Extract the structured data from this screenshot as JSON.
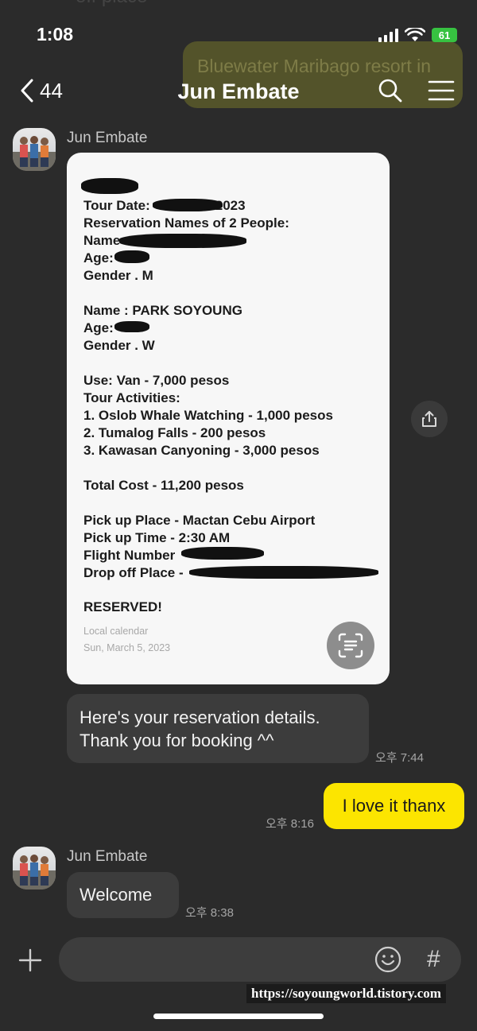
{
  "status_bar": {
    "time": "1:08",
    "battery": "61"
  },
  "header": {
    "back_count": "44",
    "title": "Jun Embate"
  },
  "background": {
    "ghost_text_top": "off place",
    "ghost_bubble_text": "Bluewater Maribago resort in"
  },
  "messages": [
    {
      "sender": "Jun Embate",
      "type": "image",
      "image_lines": {
        "tour_date": "Tour Date:",
        "tour_date_year": "2023",
        "reservation_names": "Reservation Names of 2 People:",
        "name1_label": "Name",
        "age1": "Age:",
        "gender1": "Gender . M",
        "name2": "Name : PARK SOYOUNG",
        "age2": "Age:",
        "gender2": "Gender . W",
        "use": "Use: Van - 7,000 pesos",
        "tour_activities": "Tour Activities:",
        "activity1": "1. Oslob Whale Watching - 1,000 pesos",
        "activity2": "2. Tumalog Falls - 200 pesos",
        "activity3": "3. Kawasan Canyoning - 3,000 pesos",
        "total": "Total Cost - 11,200 pesos",
        "pickup_place": "Pick up Place - Mactan Cebu Airport",
        "pickup_time": "Pick up Time - 2:30 AM",
        "flight_number": "Flight Number",
        "dropoff": "Drop off Place -",
        "reserved": "RESERVED!",
        "calendar_label": "Local calendar",
        "calendar_date": "Sun, March 5, 2023"
      }
    },
    {
      "sender": "Jun Embate",
      "type": "text",
      "line1": "Here's your reservation details.",
      "line2": "Thank you for booking ^^",
      "time": "오후 7:44"
    },
    {
      "sender": "me",
      "type": "text",
      "text": "I love it thanx",
      "time": "오후 8:16"
    },
    {
      "sender": "Jun Embate",
      "type": "text",
      "text": "Welcome",
      "time": "오후 8:38"
    }
  ],
  "input": {
    "placeholder": ""
  },
  "watermark": "https://soyoungworld.tistory.com",
  "colors": {
    "background": "#2b2b2b",
    "my_bubble": "#fce500",
    "their_bubble": "#3c3c3c"
  }
}
